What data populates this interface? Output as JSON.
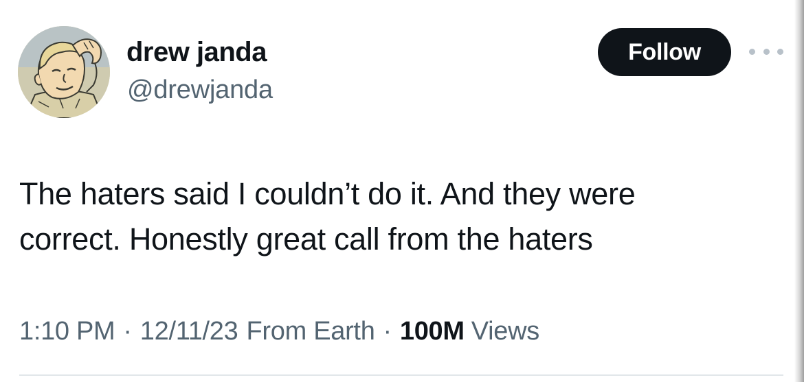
{
  "author": {
    "display_name": "drew janda",
    "handle": "@drewjanda",
    "avatar_icon": "cartoon-boy-avatar"
  },
  "follow_button": {
    "label": "Follow"
  },
  "more_menu": {
    "icon": "more-horizontal-icon"
  },
  "tweet": {
    "text_lines": [
      "The haters said I couldn’t do it. And they were",
      "correct. Honestly great call from the haters"
    ]
  },
  "meta": {
    "time": "1:10 PM",
    "date": "12/11/23",
    "location": "From Earth",
    "separator": "·",
    "views_count": "100M",
    "views_label": "Views"
  },
  "colors": {
    "primary_text": "#0f1419",
    "secondary_text": "#536471",
    "button_bg": "#0f1419",
    "button_text": "#ffffff"
  }
}
